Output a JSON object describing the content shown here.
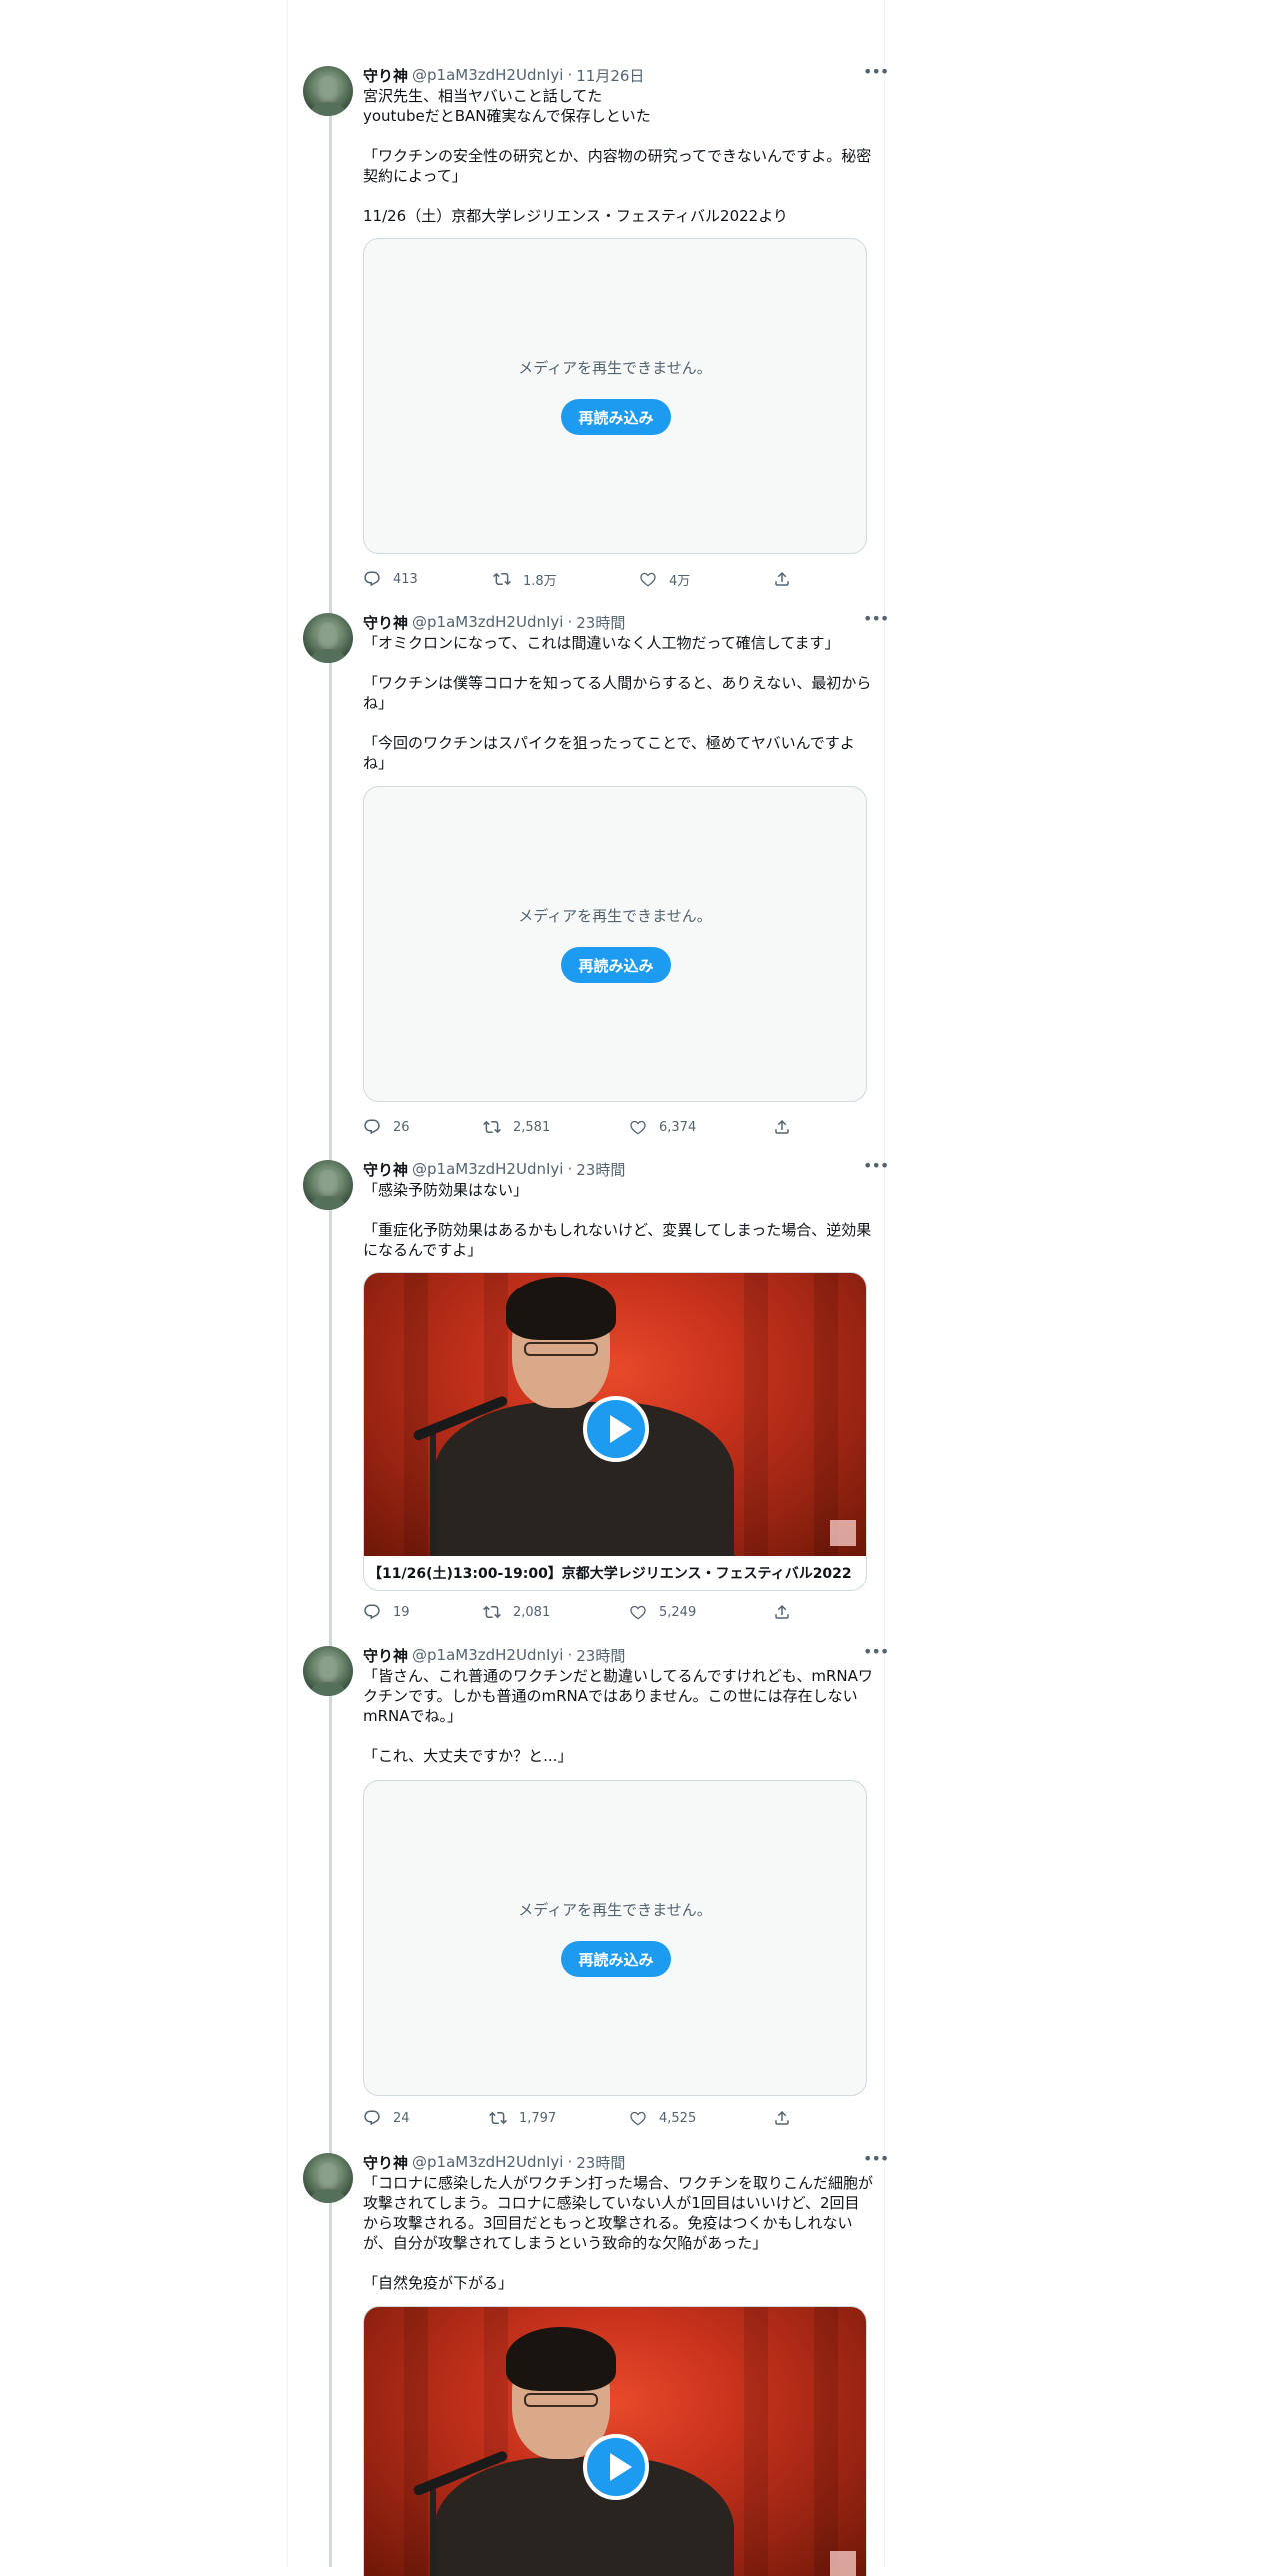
{
  "tweets": [
    {
      "name": "守り神",
      "handle": "@p1aM3zdH2UdnIyi",
      "time": "11月26日",
      "text": "宮沢先生、相当ヤバいこと話してた\nyoutubeだとBAN確実なんで保存しといた\n\n「ワクチンの安全性の研究とか、内容物の研究ってできないんですよ。秘密契約によって」\n\n11/26（土）京都大学レジリエンス・フェスティバル2022より",
      "media": {
        "kind": "error",
        "message": "メディアを再生できません。",
        "button": "再読み込み"
      },
      "replies": "413",
      "retweets": "1.8万",
      "likes": "4万"
    },
    {
      "name": "守り神",
      "handle": "@p1aM3zdH2UdnIyi",
      "time": "23時間",
      "text": "「オミクロンになって、これは間違いなく人工物だって確信してます」\n\n「ワクチンは僕等コロナを知ってる人間からすると、ありえない、最初からね」\n\n「今回のワクチンはスパイクを狙ったってことで、極めてヤバいんですよね」",
      "media": {
        "kind": "error",
        "message": "メディアを再生できません。",
        "button": "再読み込み"
      },
      "replies": "26",
      "retweets": "2,581",
      "likes": "6,374"
    },
    {
      "name": "守り神",
      "handle": "@p1aM3zdH2UdnIyi",
      "time": "23時間",
      "text": "「感染予防効果はない」\n\n「重症化予防効果はあるかもしれないけど、変異してしまった場合、逆効果になるんですよ」",
      "media": {
        "kind": "video",
        "caption": "【11/26(土)13:00-19:00】京都大学レジリエンス・フェスティバル2022"
      },
      "replies": "19",
      "retweets": "2,081",
      "likes": "5,249"
    },
    {
      "name": "守り神",
      "handle": "@p1aM3zdH2UdnIyi",
      "time": "23時間",
      "text": "「皆さん、これ普通のワクチンだと勘違いしてるんですけれども、mRNAワクチンです。しかも普通のmRNAではありません。この世には存在しないmRNAでね。」\n\n「これ、大丈夫ですか？と...」",
      "media": {
        "kind": "error",
        "message": "メディアを再生できません。",
        "button": "再読み込み"
      },
      "replies": "24",
      "retweets": "1,797",
      "likes": "4,525"
    },
    {
      "name": "守り神",
      "handle": "@p1aM3zdH2UdnIyi",
      "time": "23時間",
      "text": "「コロナに感染した人がワクチン打った場合、ワクチンを取りこんだ細胞が攻撃されてしまう。コロナに感染していない人が1回目はいいけど、2回目から攻撃される。3回目だともっと攻撃される。免疫はつくかもしれないが、自分が攻撃されてしまうという致命的な欠陥があった」\n\n「自然免疫が下がる」",
      "media": {
        "kind": "video",
        "caption": ""
      }
    }
  ],
  "colors": {
    "accent": "#1d9bf0",
    "muted": "#536471",
    "border": "#cfd9de"
  },
  "icons": {
    "reply": "reply-icon",
    "retweet": "retweet-icon",
    "like": "heart-icon",
    "share": "share-icon",
    "more": "more-icon",
    "play": "play-icon"
  }
}
